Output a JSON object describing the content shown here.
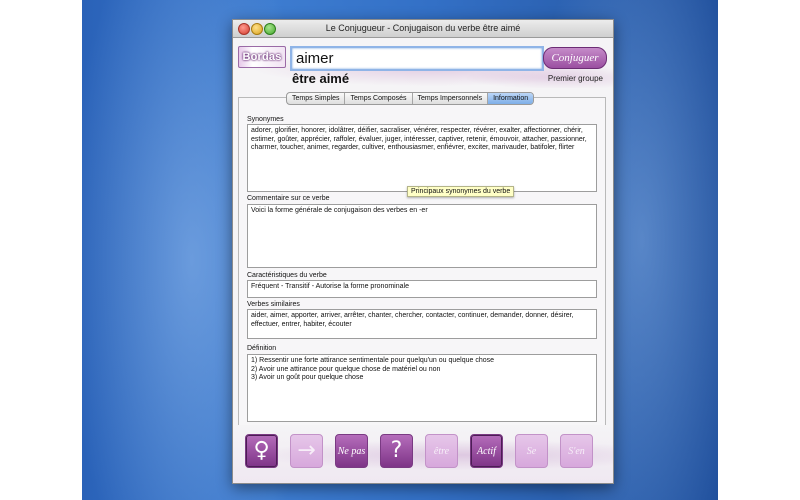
{
  "window": {
    "title": "Le Conjugueur - Conjugaison du verbe être aimé",
    "logo": "Bordas"
  },
  "search": {
    "value": "aimer",
    "button_label": "Conjuguer"
  },
  "verb": {
    "display": "être aimé",
    "group": "Premier groupe"
  },
  "tabs": [
    {
      "label": "Temps Simples",
      "active": false
    },
    {
      "label": "Temps Composés",
      "active": false
    },
    {
      "label": "Temps Impersonnels",
      "active": false
    },
    {
      "label": "Information",
      "active": true
    }
  ],
  "fields": {
    "synonymes": {
      "label": "Synonymes",
      "value": "adorer, glorifier, honorer, idolâtrer, déifier, sacraliser, vénérer, respecter, révérer, exalter, affectionner, chérir, estimer, goûter, apprécier, raffoler, évaluer, juger, intéresser, captiver, retenir, émouvoir, attacher, passionner, charmer, toucher, animer, regarder, cultiver, enthousiasmer, enfiévrer, exciter, marivauder, batifoler, flirter",
      "tooltip": "Principaux synonymes du verbe"
    },
    "commentaire": {
      "label": "Commentaire sur ce verbe",
      "value": "Voici la forme générale de conjugaison des verbes en -er"
    },
    "caracteristiques": {
      "label": "Caractéristiques du verbe",
      "value": "Fréquent - Transitif - Autorise la forme pronominale"
    },
    "similaires": {
      "label": "Verbes similaires",
      "value": "aider, aimer, apporter, arriver, arrêter, chanter, chercher, contacter, continuer, demander, donner, désirer, effectuer, entrer, habiter, écouter"
    },
    "definition": {
      "label": "Définition",
      "lines": [
        "1) Ressentir une forte attirance sentimentale pour quelqu'un ou quelque chose",
        "2) Avoir une attirance pour quelque chose de matériel ou non",
        "3) Avoir un goût pour quelque chose"
      ]
    }
  },
  "toolbar": {
    "female_symbol": "♀",
    "arrow_symbol": "→",
    "ne_pas": "Ne pas",
    "question": "?",
    "etre": "être",
    "actif": "Actif",
    "se": "Se",
    "sen": "S'en"
  }
}
